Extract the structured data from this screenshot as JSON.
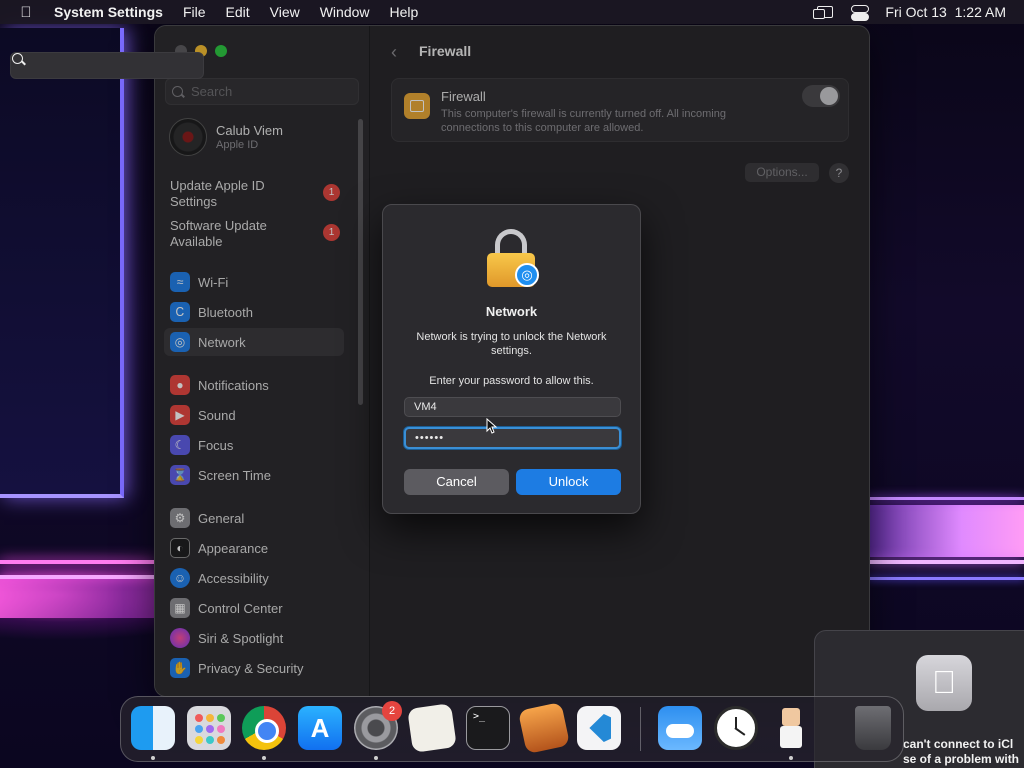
{
  "menubar": {
    "app_name": "System Settings",
    "menus": [
      "File",
      "Edit",
      "View",
      "Window",
      "Help"
    ],
    "clock": "Fri Oct 13  1:22 AM"
  },
  "sidebar": {
    "search_placeholder": "Search",
    "account": {
      "name": "Calub Viem",
      "subtitle": "Apple ID"
    },
    "notices": [
      {
        "label": "Update Apple ID Settings",
        "badge": "1"
      },
      {
        "label": "Software Update Available",
        "badge": "1"
      }
    ],
    "items": [
      {
        "label": "Wi-Fi",
        "icon": "wifi-icon",
        "color": "#1f7ee8"
      },
      {
        "label": "Bluetooth",
        "icon": "bluetooth-icon",
        "color": "#1f7ee8"
      },
      {
        "label": "Network",
        "icon": "globe-icon",
        "color": "#1f7ee8"
      },
      {
        "label": "Notifications",
        "icon": "bell-icon",
        "color": "#e5443f"
      },
      {
        "label": "Sound",
        "icon": "speaker-icon",
        "color": "#e5443f"
      },
      {
        "label": "Focus",
        "icon": "moon-icon",
        "color": "#5e5ce6"
      },
      {
        "label": "Screen Time",
        "icon": "hourglass-icon",
        "color": "#5e5ce6"
      },
      {
        "label": "General",
        "icon": "gear-icon",
        "color": "#8e8e93"
      },
      {
        "label": "Appearance",
        "icon": "appearance-icon",
        "color": "#1c1c1e"
      },
      {
        "label": "Accessibility",
        "icon": "accessibility-icon",
        "color": "#1f7ee8"
      },
      {
        "label": "Control Center",
        "icon": "control-center-icon",
        "color": "#8e8e93"
      },
      {
        "label": "Siri & Spotlight",
        "icon": "siri-icon",
        "color": "#c43fd1"
      },
      {
        "label": "Privacy & Security",
        "icon": "hand-icon",
        "color": "#1f7ee8"
      }
    ],
    "selected": "Network"
  },
  "content": {
    "title": "Firewall",
    "firewall": {
      "label": "Firewall",
      "description": "This computer's firewall is currently turned off. All incoming connections to this computer are allowed.",
      "enabled": false
    },
    "options_label": "Options...",
    "help_label": "?"
  },
  "dialog": {
    "title": "Network",
    "message": "Network is trying to unlock the Network settings.",
    "prompt": "Enter your password to allow this.",
    "username": "VM4",
    "password_masked": "••••••",
    "cancel_label": "Cancel",
    "unlock_label": "Unlock"
  },
  "notification": {
    "line1": "can't connect to iCl",
    "line2": "se of a problem with"
  },
  "dock": {
    "settings_badge": "2",
    "apps": [
      "Finder",
      "Launchpad",
      "Google Chrome",
      "App Store",
      "System Settings",
      "TextEdit",
      "Terminal",
      "GarageBand",
      "Visual Studio Code",
      "Weather",
      "Clock",
      "Character",
      "Trash"
    ]
  }
}
